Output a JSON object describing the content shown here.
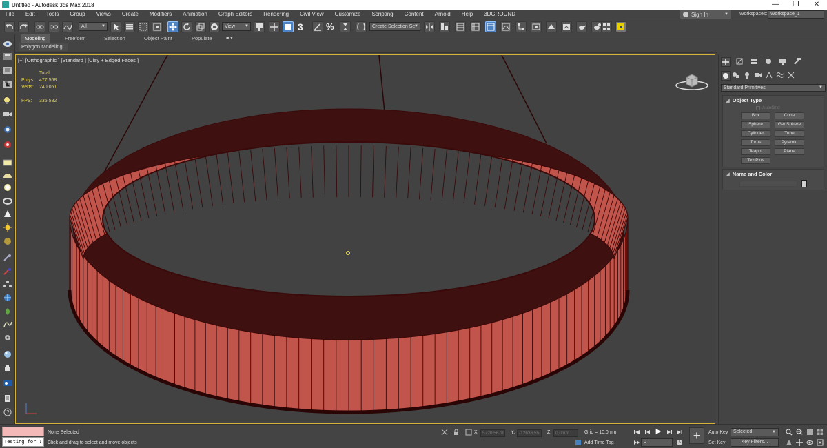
{
  "window": {
    "title": "Untitled - Autodesk 3ds Max 2018",
    "controls": [
      "—",
      "❐",
      "✕"
    ]
  },
  "menu": {
    "items": [
      "File",
      "Edit",
      "Tools",
      "Group",
      "Views",
      "Create",
      "Modifiers",
      "Animation",
      "Graph Editors",
      "Rendering",
      "Civil View",
      "Customize",
      "Scripting",
      "Content",
      "Arnold",
      "Help",
      "3DGROUND"
    ],
    "sign_in": "Sign In",
    "workspaces_label": "Workspaces:",
    "workspace_value": "Workspace_1"
  },
  "toolbar": {
    "selection_filter": "All",
    "reference_coord": "View",
    "named_selection": "Create Selection Se",
    "snap_3": "3",
    "snap_percent": "%"
  },
  "ribbon": {
    "tabs": [
      "Modeling",
      "Freeform",
      "Selection",
      "Object Paint",
      "Populate"
    ],
    "active_tab": "Modeling",
    "sub_label": "Polygon Modeling"
  },
  "viewport": {
    "label": "[+] [Orthographic ] [Standard ] [Clay + Edged Faces ]",
    "stats": {
      "total_label": "Total",
      "polys_label": "Polys:",
      "polys_value": "477 568",
      "verts_label": "Verts:",
      "verts_value": "240 051",
      "fps_label": "FPS:",
      "fps_value": "335,582"
    },
    "mesh_color": "#c1544b",
    "wire_color": "#3a0a0a"
  },
  "command_panel": {
    "category": "Standard Primitives",
    "object_type_title": "Object Type",
    "autogrid": "AutoGrid",
    "primitives": [
      "Box",
      "Cone",
      "Sphere",
      "GeoSphere",
      "Cylinder",
      "Tube",
      "Torus",
      "Pyramid",
      "Teapot",
      "Plane",
      "TextPlus"
    ],
    "name_color_title": "Name and Color"
  },
  "status": {
    "maxscript_output": "Testing for :",
    "selection": "None Selected",
    "prompt": "Click and drag to select and move objects",
    "x_label": "X:",
    "x_value": "5720,567m",
    "y_label": "Y:",
    "y_value": "-12636,55",
    "z_label": "Z:",
    "z_value": "0,0mm",
    "grid": "Grid = 10,0mm",
    "add_time_tag": "Add Time Tag",
    "frame": "0",
    "auto_key": "Auto Key",
    "set_key": "Set Key",
    "key_mode": "Selected",
    "key_filters": "Key Filters..."
  }
}
